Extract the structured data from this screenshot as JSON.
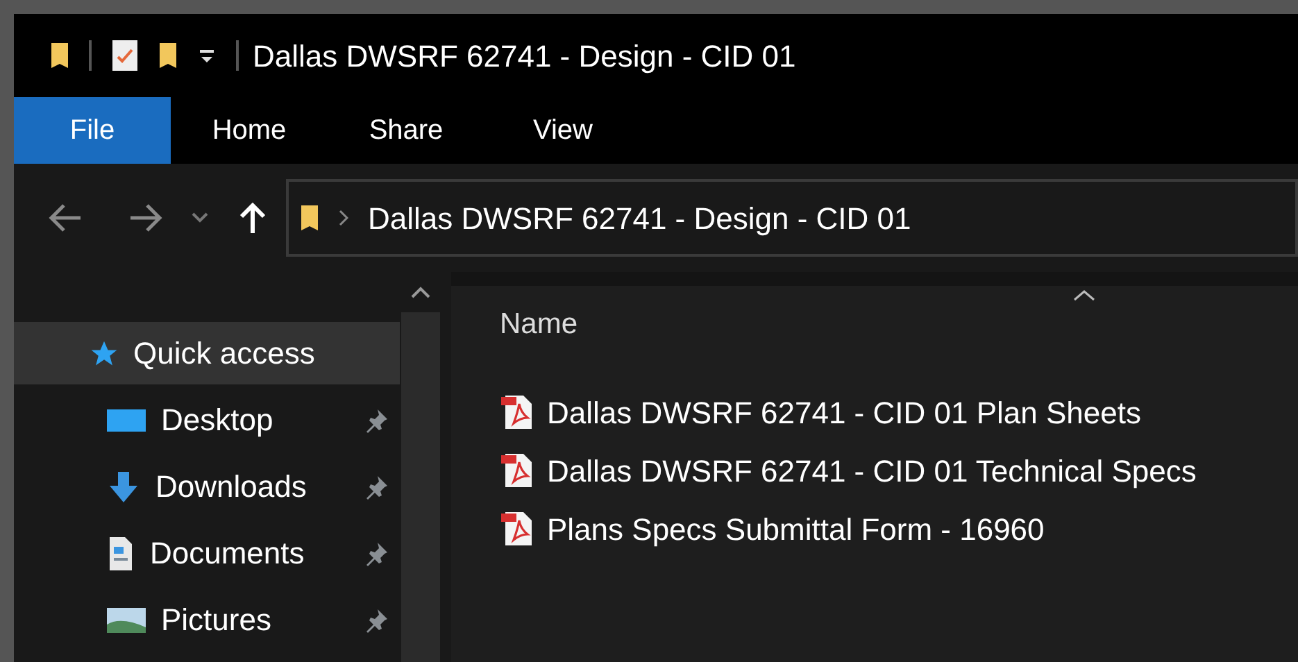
{
  "window": {
    "title": "Dallas DWSRF 62741 - Design - CID 01"
  },
  "tabs": [
    {
      "label": "File",
      "selected": true
    },
    {
      "label": "Home",
      "selected": false
    },
    {
      "label": "Share",
      "selected": false
    },
    {
      "label": "View",
      "selected": false
    }
  ],
  "address": {
    "path": "Dallas DWSRF 62741 - Design - CID 01"
  },
  "sidebar": {
    "items": [
      {
        "label": "Quick access",
        "kind": "star",
        "selected": true,
        "pinned": false
      },
      {
        "label": "Desktop",
        "kind": "desktop",
        "selected": false,
        "pinned": true
      },
      {
        "label": "Downloads",
        "kind": "download",
        "selected": false,
        "pinned": true
      },
      {
        "label": "Documents",
        "kind": "document",
        "selected": false,
        "pinned": true
      },
      {
        "label": "Pictures",
        "kind": "picture",
        "selected": false,
        "pinned": true
      }
    ]
  },
  "table": {
    "columns": [
      "Name"
    ],
    "rows": [
      {
        "name": "Dallas DWSRF 62741 - CID 01 Plan Sheets"
      },
      {
        "name": "Dallas DWSRF 62741 - CID 01 Technical Specs"
      },
      {
        "name": "Plans Specs Submittal Form - 16960"
      }
    ]
  }
}
